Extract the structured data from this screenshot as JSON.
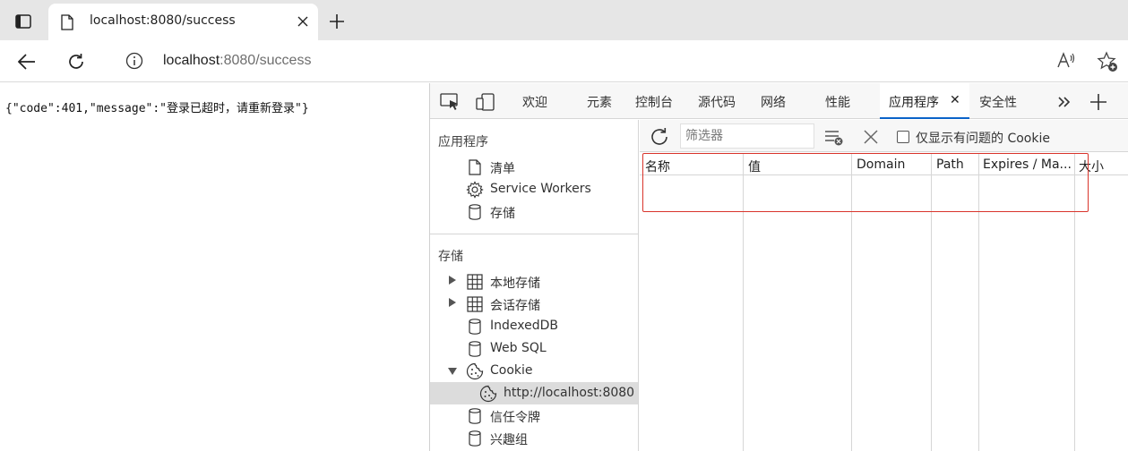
{
  "browser": {
    "tab_title": "localhost:8080/success",
    "url_host": "localhost",
    "url_rest": ":8080/success"
  },
  "page": {
    "body_text": "{\"code\":401,\"message\":\"登录已超时，请重新登录\"}"
  },
  "devtools": {
    "tabs": [
      "欢迎",
      "元素",
      "控制台",
      "源代码",
      "网络",
      "性能",
      "应用程序",
      "安全性"
    ],
    "active_tab": "应用程序",
    "sidebar": {
      "section_app": "应用程序",
      "app_items": [
        "清单",
        "Service Workers",
        "存储"
      ],
      "section_storage": "存储",
      "storage_items": [
        "本地存储",
        "会话存储",
        "IndexedDB",
        "Web SQL",
        "Cookie"
      ],
      "cookie_child": "http://localhost:8080",
      "more_items": [
        "信任令牌",
        "兴趣组"
      ]
    },
    "toolbar": {
      "filter_placeholder": "筛选器",
      "only_issues_label": "仅显示有问题的 Cookie"
    },
    "grid": {
      "columns": [
        "名称",
        "值",
        "Domain",
        "Path",
        "Expires / Ma...",
        "大小"
      ]
    },
    "colors": {
      "highlight": "#d9342b",
      "active_tab_underline": "#0a63c9"
    }
  }
}
